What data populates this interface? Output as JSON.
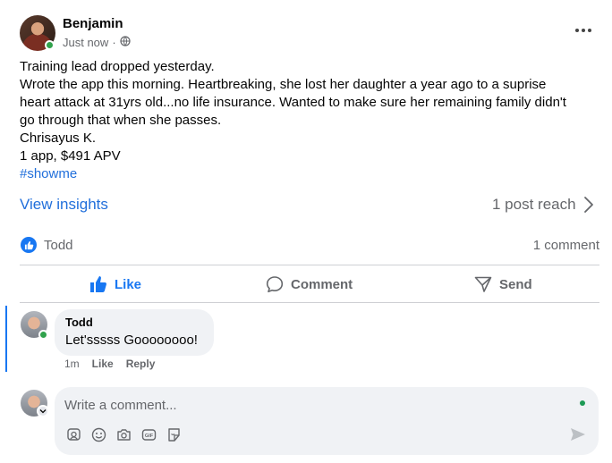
{
  "post": {
    "author": "Benjamin",
    "timestamp": "Just now",
    "privacy_icon": "globe-icon",
    "lines": [
      "Training lead dropped yesterday.",
      "Wrote the app this morning.  Heartbreaking, she lost her daughter a year ago to a suprise",
      "heart attack at 31yrs old...no life insurance.  Wanted to make sure her remaining family didn't",
      "go through that when she passes.",
      "Chrisayus K.",
      "1 app, $491 APV"
    ],
    "hashtag": "#showme"
  },
  "insights": {
    "label": "View insights",
    "reach": "1 post reach"
  },
  "reactions": {
    "likers": "Todd",
    "comment_count": "1 comment"
  },
  "actions": {
    "like": "Like",
    "comment": "Comment",
    "send": "Send"
  },
  "comment": {
    "author": "Todd",
    "text": "Let'sssss Goooooooo!",
    "time": "1m",
    "like": "Like",
    "reply": "Reply"
  },
  "composer": {
    "placeholder": "Write a comment..."
  },
  "colors": {
    "accent": "#1877f2",
    "link": "#216fdb",
    "online": "#31a24c",
    "muted": "#65676b",
    "bubble": "#f0f2f5"
  }
}
